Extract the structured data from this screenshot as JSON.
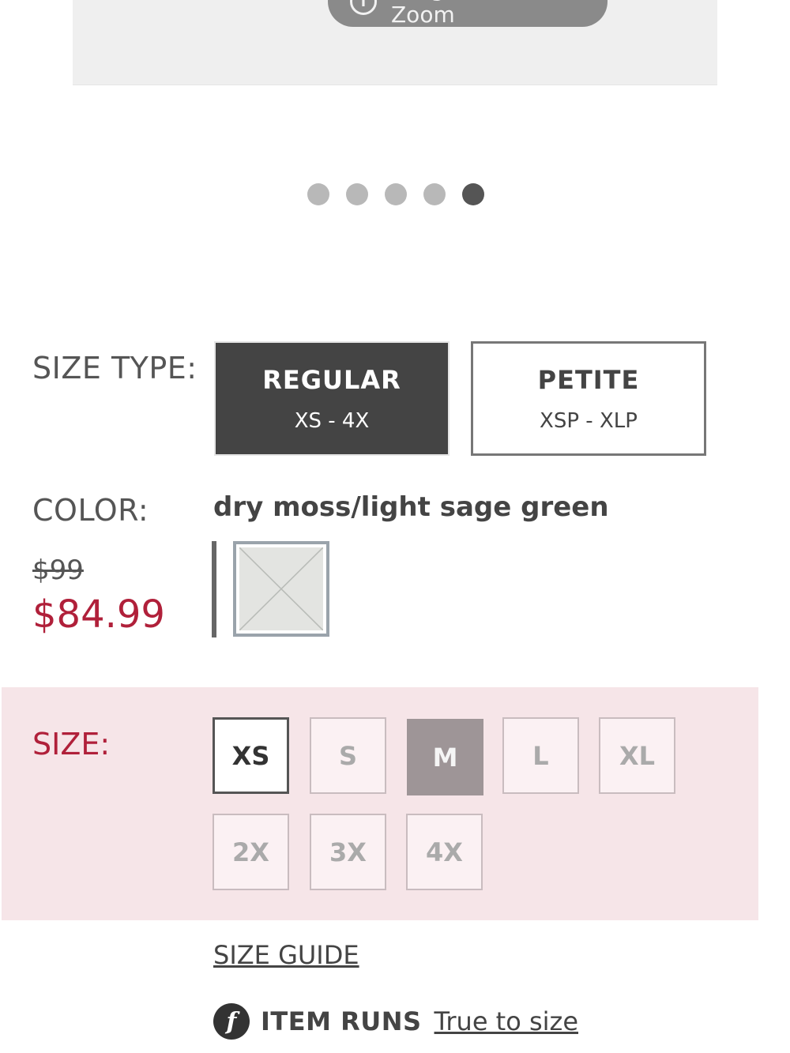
{
  "zoom_hint": "Long-Touch to Zoom",
  "carousel": {
    "total": 5,
    "active_index": 4
  },
  "size_type": {
    "label": "SIZE TYPE:",
    "options": [
      {
        "title": "REGULAR",
        "range": "XS - 4X",
        "selected": true
      },
      {
        "title": "PETITE",
        "range": "XSP - XLP",
        "selected": false
      }
    ]
  },
  "color": {
    "label": "COLOR:",
    "name": "dry moss/light sage green"
  },
  "price": {
    "original": "$99",
    "sale": "$84.99"
  },
  "size": {
    "label": "SIZE:",
    "options": [
      {
        "label": "XS",
        "state": "available"
      },
      {
        "label": "S",
        "state": "unavailable"
      },
      {
        "label": "M",
        "state": "selected"
      },
      {
        "label": "L",
        "state": "unavailable"
      },
      {
        "label": "XL",
        "state": "unavailable"
      },
      {
        "label": "2X",
        "state": "unavailable"
      },
      {
        "label": "3X",
        "state": "unavailable"
      },
      {
        "label": "4X",
        "state": "unavailable"
      }
    ]
  },
  "size_guide": "SIZE GUIDE",
  "fit": {
    "icon": "f",
    "title": "ITEM RUNS",
    "value": "True to size"
  },
  "colors": {
    "sale": "#b0203a",
    "size_panel": "#f6e5e8",
    "dark": "#444444"
  }
}
